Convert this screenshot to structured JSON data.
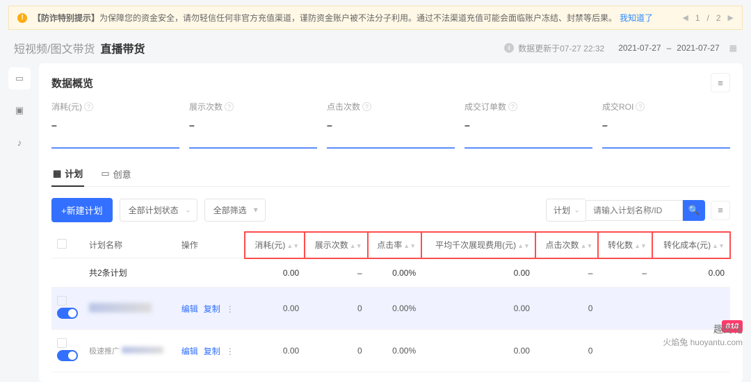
{
  "alert": {
    "prefix": "【防诈特别提示】",
    "text": "为保障您的资金安全，请勿轻信任何非官方充值渠道，谨防资金账户被不法分子利用。通过不法渠道充值可能会面临账户冻结、封禁等后果。",
    "link": "我知道了"
  },
  "pager": {
    "cur": "1",
    "sep": "/",
    "total": "2"
  },
  "breadcrumb": {
    "parent": "短视频/图文带货",
    "current": "直播带货"
  },
  "update": {
    "label": "数据更新于07-27 22:32",
    "from": "2021-07-27",
    "dash": "–",
    "to": "2021-07-27"
  },
  "overview": {
    "title": "数据概览"
  },
  "metrics": [
    {
      "label": "消耗(元)",
      "value": "–"
    },
    {
      "label": "展示次数",
      "value": "–"
    },
    {
      "label": "点击次数",
      "value": "–"
    },
    {
      "label": "成交订单数",
      "value": "–"
    },
    {
      "label": "成交ROI",
      "value": "–"
    }
  ],
  "tabs": {
    "plan": "计划",
    "creative": "创意"
  },
  "toolbar": {
    "new": "+新建计划",
    "status": "全部计划状态",
    "filter": "全部筛选",
    "searchType": "计划",
    "searchPh": "请输入计划名称/ID"
  },
  "table": {
    "cols": {
      "name": "计划名称",
      "op": "操作",
      "spend": "消耗(元)",
      "show": "展示次数",
      "ctr": "点击率",
      "cpm": "平均千次展现费用(元)",
      "click": "点击次数",
      "conv": "转化数",
      "cost": "转化成本(元)"
    },
    "summary": {
      "label": "共2条计划",
      "spend": "0.00",
      "show": "–",
      "ctr": "0.00%",
      "cpm": "0.00",
      "click": "–",
      "conv": "–",
      "cost": "0.00"
    },
    "rows": [
      {
        "spend": "0.00",
        "show": "0",
        "ctr": "0.00%",
        "cpm": "0.00",
        "click": "0"
      },
      {
        "sub": "极速推广",
        "spend": "0.00",
        "show": "0",
        "ctr": "0.00%",
        "cpm": "0.00",
        "click": "0"
      }
    ],
    "actions": {
      "edit": "编辑",
      "copy": "复制"
    }
  },
  "badge": "818",
  "watermark": {
    "cn": "趣街花",
    "py": "火焰兔 huoyantu.com"
  }
}
